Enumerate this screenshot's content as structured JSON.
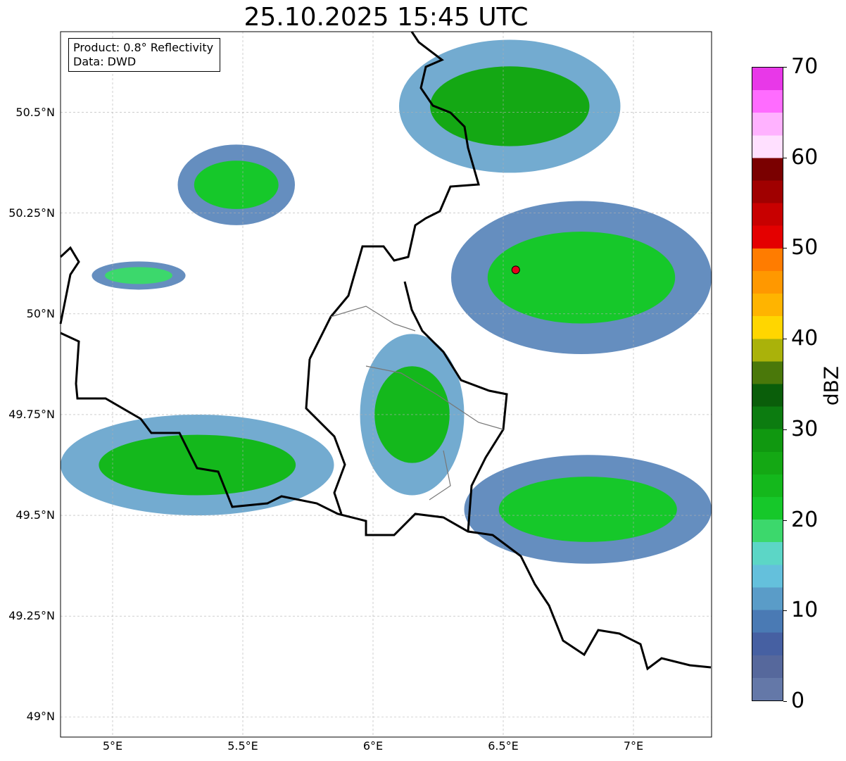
{
  "title": "25.10.2025 15:45 UTC",
  "info_box": {
    "product": "Product: 0.8° Reflectivity",
    "data": "Data: DWD"
  },
  "map": {
    "lon_range": [
      4.8,
      7.3
    ],
    "lat_range": [
      48.95,
      50.7
    ],
    "lat_ticks": [
      {
        "value": 50.5,
        "label": "50.5°N"
      },
      {
        "value": 50.25,
        "label": "50.25°N"
      },
      {
        "value": 50.0,
        "label": "50°N"
      },
      {
        "value": 49.75,
        "label": "49.75°N"
      },
      {
        "value": 49.5,
        "label": "49.5°N"
      },
      {
        "value": 49.25,
        "label": "49.25°N"
      },
      {
        "value": 49.0,
        "label": "49°N"
      }
    ],
    "lon_ticks": [
      {
        "value": 5.0,
        "label": "5°E"
      },
      {
        "value": 5.5,
        "label": "5.5°E"
      },
      {
        "value": 6.0,
        "label": "6°E"
      },
      {
        "value": 6.5,
        "label": "6.5°E"
      },
      {
        "value": 7.0,
        "label": "7°E"
      }
    ],
    "grid": true,
    "radar_site": {
      "lon": 6.548,
      "lat": 50.109,
      "color": "#e8001c"
    },
    "echo_bands": [
      {
        "lon": [
          4.92,
          5.28
        ],
        "lat": [
          50.06,
          50.13
        ],
        "level": 18
      },
      {
        "lon": [
          5.25,
          5.7
        ],
        "lat": [
          50.22,
          50.42
        ],
        "level": 20
      },
      {
        "lon": [
          5.95,
          6.35
        ],
        "lat": [
          49.55,
          49.95
        ],
        "level": 24
      },
      {
        "lon": [
          4.8,
          5.85
        ],
        "lat": [
          49.5,
          49.75
        ],
        "level": 24
      },
      {
        "lon": [
          6.1,
          6.95
        ],
        "lat": [
          50.35,
          50.68
        ],
        "level": 26
      },
      {
        "lon": [
          6.3,
          7.3
        ],
        "lat": [
          49.9,
          50.28
        ],
        "level": 20
      },
      {
        "lon": [
          6.35,
          7.3
        ],
        "lat": [
          49.38,
          49.65
        ],
        "level": 22
      }
    ]
  },
  "colorbar": {
    "label": "dBZ",
    "min": 0,
    "max": 70,
    "ticks": [
      0,
      10,
      20,
      30,
      40,
      50,
      60,
      70
    ],
    "colors": [
      "#6478a8",
      "#56689c",
      "#4660a2",
      "#4a7ab4",
      "#5a9cc8",
      "#64c0dc",
      "#5cd6c6",
      "#3cd86c",
      "#16c82a",
      "#14b81c",
      "#14a814",
      "#109810",
      "#0c7c10",
      "#0a5e0a",
      "#4a780a",
      "#aab20a",
      "#ffd600",
      "#ffb400",
      "#ff9800",
      "#ff7c00",
      "#e40000",
      "#c80000",
      "#a00000",
      "#7a0000",
      "#ffe0ff",
      "#ffb2ff",
      "#ff6cff",
      "#e838e8"
    ]
  }
}
